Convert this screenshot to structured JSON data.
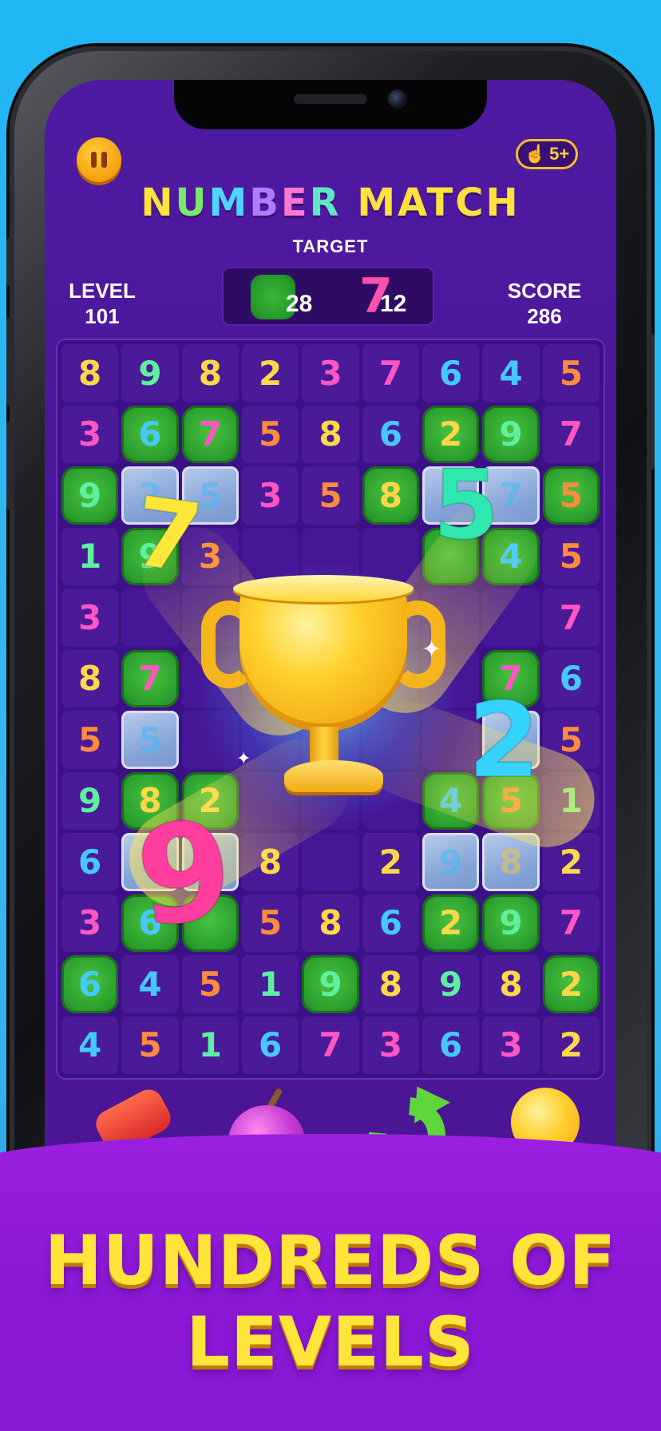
{
  "header": {
    "title_letters": [
      "N",
      "U",
      "M",
      "B",
      "E",
      "R",
      " ",
      "M",
      "A",
      "T",
      "C",
      "H"
    ],
    "target_label": "TARGET",
    "target": {
      "leaf_count": "28",
      "digit": "7",
      "digit_count": "12"
    },
    "level": {
      "label": "LEVEL",
      "value": "101"
    },
    "score": {
      "label": "SCORE",
      "value": "286"
    },
    "hint_count": "5+"
  },
  "board": {
    "rows": [
      [
        [
          "8",
          "yellow",
          ""
        ],
        [
          "9",
          "green",
          ""
        ],
        [
          "8",
          "yellow",
          ""
        ],
        [
          "2",
          "yellow",
          ""
        ],
        [
          "3",
          "pink",
          ""
        ],
        [
          "7",
          "pink",
          ""
        ],
        [
          "6",
          "blue",
          ""
        ],
        [
          "4",
          "blue",
          ""
        ],
        [
          "5",
          "orange",
          ""
        ]
      ],
      [
        [
          "3",
          "pink",
          ""
        ],
        [
          "6",
          "blue",
          "leaf"
        ],
        [
          "7",
          "pink",
          "leaf"
        ],
        [
          "5",
          "orange",
          ""
        ],
        [
          "8",
          "yellow",
          ""
        ],
        [
          "6",
          "blue",
          ""
        ],
        [
          "2",
          "yellow",
          "leaf"
        ],
        [
          "9",
          "green",
          "leaf"
        ],
        [
          "7",
          "pink",
          ""
        ]
      ],
      [
        [
          "9",
          "green",
          "leaf"
        ],
        [
          "2",
          "blue",
          "ice"
        ],
        [
          "5",
          "blue",
          "ice"
        ],
        [
          "3",
          "pink",
          ""
        ],
        [
          "5",
          "orange",
          ""
        ],
        [
          "8",
          "yellow",
          "leaf"
        ],
        [
          "",
          "",
          "ice"
        ],
        [
          "7",
          "blue",
          "ice"
        ],
        [
          "5",
          "orange",
          "leaf"
        ]
      ],
      [
        [
          "1",
          "green",
          ""
        ],
        [
          "9",
          "green",
          "leaf"
        ],
        [
          "3",
          "orange",
          ""
        ],
        [
          "",
          "",
          "empty"
        ],
        [
          "",
          "",
          "empty"
        ],
        [
          "",
          "",
          "empty"
        ],
        [
          "",
          "",
          "leaf"
        ],
        [
          "4",
          "blue",
          "leaf"
        ],
        [
          "5",
          "orange",
          ""
        ]
      ],
      [
        [
          "3",
          "pink",
          ""
        ],
        [
          "",
          "",
          "empty"
        ],
        [
          "",
          "",
          "empty"
        ],
        [
          "",
          "",
          "empty"
        ],
        [
          "",
          "",
          "empty"
        ],
        [
          "",
          "",
          "empty"
        ],
        [
          "",
          "",
          "empty"
        ],
        [
          "",
          "",
          "empty"
        ],
        [
          "7",
          "pink",
          ""
        ]
      ],
      [
        [
          "8",
          "yellow",
          ""
        ],
        [
          "7",
          "pink",
          "leaf"
        ],
        [
          "",
          "",
          "empty"
        ],
        [
          "",
          "",
          "empty"
        ],
        [
          "",
          "",
          "empty"
        ],
        [
          "",
          "",
          "empty"
        ],
        [
          "",
          "",
          "empty"
        ],
        [
          "7",
          "pink",
          "leaf"
        ],
        [
          "6",
          "blue",
          ""
        ]
      ],
      [
        [
          "5",
          "orange",
          ""
        ],
        [
          "5",
          "blue",
          "ice"
        ],
        [
          "",
          "",
          "empty"
        ],
        [
          "",
          "",
          "empty"
        ],
        [
          "",
          "",
          "empty"
        ],
        [
          "",
          "",
          "empty"
        ],
        [
          "",
          "",
          "empty"
        ],
        [
          "",
          "",
          "ice"
        ],
        [
          "5",
          "orange",
          ""
        ]
      ],
      [
        [
          "9",
          "green",
          ""
        ],
        [
          "8",
          "yellow",
          "leaf"
        ],
        [
          "2",
          "yellow",
          "leaf"
        ],
        [
          "",
          "",
          "empty"
        ],
        [
          "",
          "",
          "empty"
        ],
        [
          "",
          "",
          "empty"
        ],
        [
          "4",
          "blue",
          "leaf"
        ],
        [
          "5",
          "orange",
          "leaf"
        ],
        [
          "1",
          "green",
          ""
        ]
      ],
      [
        [
          "6",
          "blue",
          ""
        ],
        [
          "",
          "",
          "ice"
        ],
        [
          "",
          "",
          "ice"
        ],
        [
          "8",
          "yellow",
          ""
        ],
        [
          "",
          "",
          "empty"
        ],
        [
          "2",
          "yellow",
          ""
        ],
        [
          "9",
          "blue",
          "ice"
        ],
        [
          "8",
          "yellow",
          "ice"
        ],
        [
          "2",
          "yellow",
          ""
        ]
      ],
      [
        [
          "3",
          "pink",
          ""
        ],
        [
          "6",
          "blue",
          "leaf"
        ],
        [
          "",
          "",
          "leaf"
        ],
        [
          "5",
          "orange",
          ""
        ],
        [
          "8",
          "yellow",
          ""
        ],
        [
          "6",
          "blue",
          ""
        ],
        [
          "2",
          "yellow",
          "leaf"
        ],
        [
          "9",
          "green",
          "leaf"
        ],
        [
          "7",
          "pink",
          ""
        ]
      ],
      [
        [
          "6",
          "blue",
          "leaf"
        ],
        [
          "4",
          "blue",
          ""
        ],
        [
          "5",
          "orange",
          ""
        ],
        [
          "1",
          "green",
          ""
        ],
        [
          "9",
          "green",
          "leaf"
        ],
        [
          "8",
          "yellow",
          ""
        ],
        [
          "9",
          "green",
          ""
        ],
        [
          "8",
          "yellow",
          ""
        ],
        [
          "2",
          "yellow",
          "leaf"
        ]
      ],
      [
        [
          "4",
          "blue",
          ""
        ],
        [
          "5",
          "orange",
          ""
        ],
        [
          "1",
          "green",
          ""
        ],
        [
          "6",
          "blue",
          ""
        ],
        [
          "7",
          "pink",
          ""
        ],
        [
          "3",
          "pink",
          ""
        ],
        [
          "6",
          "blue",
          ""
        ],
        [
          "3",
          "pink",
          ""
        ],
        [
          "2",
          "yellow",
          ""
        ]
      ]
    ]
  },
  "effects": {
    "flying_numbers": [
      {
        "digit": "7",
        "color": "#ffe83a"
      },
      {
        "digit": "5",
        "color": "#2ee8b0"
      },
      {
        "digit": "2",
        "color": "#35d4ff"
      },
      {
        "digit": "9",
        "color": "#ff3ea0"
      }
    ]
  },
  "powerups": [
    {
      "name": "hammer"
    },
    {
      "name": "bomb"
    },
    {
      "name": "undo"
    },
    {
      "name": "hint-bulb"
    }
  ],
  "banner": {
    "line1": "HUNDREDS OF",
    "line2": "LEVELS"
  },
  "colors": {
    "yellow": "#ffd84a",
    "green": "#5ef0a0",
    "blue": "#46c8ff",
    "pink": "#ff56c4",
    "orange": "#ff8c3c"
  }
}
